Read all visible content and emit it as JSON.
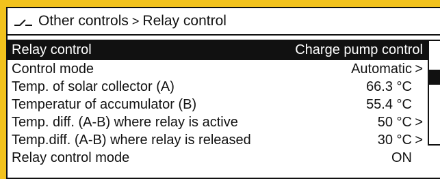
{
  "breadcrumb": {
    "icon": "relay-icon",
    "parent": "Other controls",
    "separator": ">",
    "current": "Relay control"
  },
  "rows": [
    {
      "label": "Relay control",
      "value": "Charge pump control",
      "arrow": ""
    },
    {
      "label": "Control mode",
      "value": "Automatic",
      "arrow": ">"
    },
    {
      "label": "Temp. of solar collector  (A)",
      "value": "66.3 °C",
      "arrow": ""
    },
    {
      "label": "Temperatur of accumulator (B)",
      "value": "55.4 °C",
      "arrow": ""
    },
    {
      "label": "Temp. diff.  (A-B) where relay is active",
      "value": "50 °C",
      "arrow": ">"
    },
    {
      "label": "Temp.diff. (A-B) where relay is released",
      "value": "30 °C",
      "arrow": ">"
    },
    {
      "label": "Relay control mode",
      "value": "ON",
      "arrow": ""
    }
  ],
  "colors": {
    "background": "#f2c21d",
    "panel": "#ffffff",
    "ink": "#111111"
  }
}
